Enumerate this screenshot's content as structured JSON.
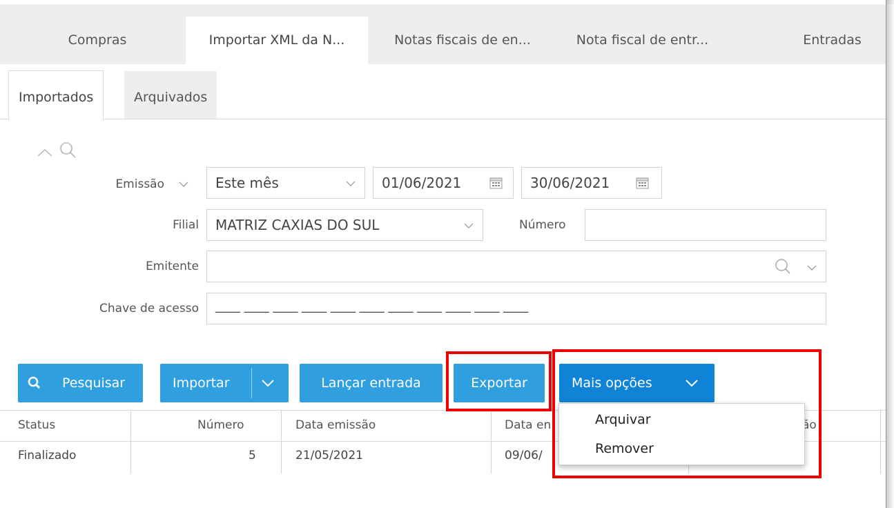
{
  "main_tabs": [
    {
      "label": "Compras"
    },
    {
      "label": "Importar XML da N..."
    },
    {
      "label": "Notas fiscais de en..."
    },
    {
      "label": "Nota fiscal de entr..."
    },
    {
      "label": "Entradas"
    }
  ],
  "sub_tabs": [
    {
      "label": "Importados"
    },
    {
      "label": "Arquivados"
    }
  ],
  "filters": {
    "emissao_label": "Emissão",
    "periodo_value": "Este mês",
    "date_start": "01/06/2021",
    "date_end": "30/06/2021",
    "filial_label": "Filial",
    "filial_value": "MATRIZ CAXIAS DO SUL",
    "numero_label": "Número",
    "numero_value": "",
    "emitente_label": "Emitente",
    "emitente_value": "",
    "chave_label": "Chave de acesso",
    "chave_mask": "____ ____ ____ ____ ____ ____ ____ ____ ____ ____ ____"
  },
  "toolbar": {
    "pesquisar": "Pesquisar",
    "importar": "Importar",
    "lancar_entrada": "Lançar entrada",
    "exportar": "Exportar",
    "mais_opcoes": "Mais opções"
  },
  "menu": {
    "items": [
      "Arquivar",
      "Remover"
    ]
  },
  "table": {
    "columns": [
      "Status",
      "Número",
      "Data emissão",
      "Data en",
      "ão"
    ],
    "rows": [
      {
        "status": "Finalizado",
        "numero": "5",
        "data_emissao": "21/05/2021",
        "data_entrada": "09/06/"
      }
    ]
  },
  "colors": {
    "button": "#2f9fe0",
    "button_active": "#1183d6",
    "highlight": "#ee0000"
  }
}
